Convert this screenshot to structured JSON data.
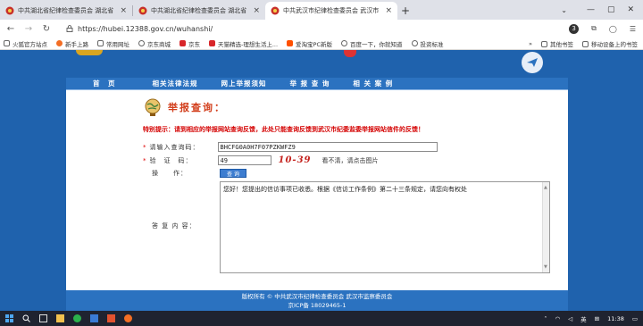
{
  "browser": {
    "tabs": [
      {
        "title": "中共湖北省纪律检查委员会 湖北省",
        "active": false
      },
      {
        "title": "中共湖北省纪律检查委员会 湖北省",
        "active": false
      },
      {
        "title": "中共武汉市纪律检查委员会 武汉市",
        "active": true
      }
    ],
    "new_tab_label": "+",
    "close_label": "×",
    "tab_menu": "⌄",
    "window_controls": {
      "minimize": "—",
      "maximize": "▢",
      "close": "✕"
    },
    "url": "https://hubei.12388.gov.cn/wuhanshi/",
    "extension_badge": "3"
  },
  "bookmarks": {
    "items": [
      "火狐官方站点",
      "新手上路",
      "常用网址",
      "京东商城",
      "京东",
      "天猫精选-理想生活上...",
      "爱淘宝PC新版",
      "百度一下，你就知道",
      "投资标准"
    ],
    "right": [
      "其他书签",
      "移动设备上的书签"
    ]
  },
  "site": {
    "nav": [
      "首　页",
      "相关法律法规",
      "网上举报须知",
      "举 报 查 询",
      "相 关 案 例"
    ],
    "query_title": "举报查询：",
    "hint": "特别提示：请到相应的举报网站查询反馈，此处只能查询反馈到武汉市纪委监委举报网站信件的反馈！",
    "form": {
      "code_label": "请输入查询码：",
      "code_value": "BHCFG0A0H7F07PZKWFZ9",
      "captcha_label": "验　证　码：",
      "captcha_value": "49",
      "captcha_image_text": "10-39",
      "captcha_hint": "看不清，请点击图片",
      "op_label": "操　　作：",
      "query_button": "查 询",
      "reply_label": "答 复 内 容：",
      "reply_text": "您好！您提出的信访事项已收悉。根据《信访工作条例》第二十三条规定，请您向有权处"
    },
    "footer_line1": "版权所有 © 中共武汉市纪律检查委员会 武汉市监察委员会",
    "footer_line2": "京ICP备 18029465-1"
  },
  "taskbar": {
    "tray_text": "英",
    "clock": "11:38"
  }
}
